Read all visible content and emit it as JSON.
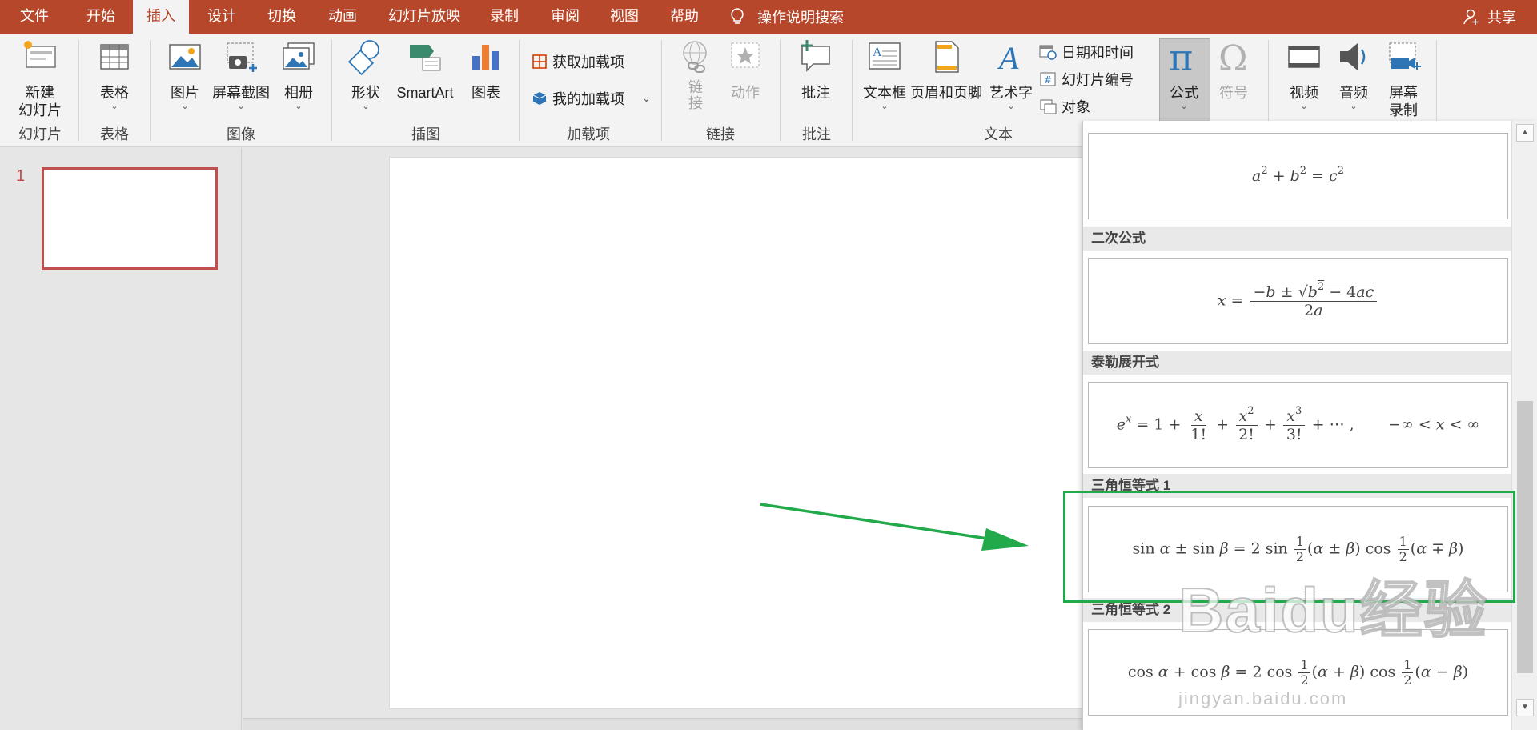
{
  "tabs": [
    "文件",
    "开始",
    "插入",
    "设计",
    "切换",
    "动画",
    "幻灯片放映",
    "录制",
    "审阅",
    "视图",
    "帮助"
  ],
  "active_tab": "插入",
  "tell_me": "操作说明搜索",
  "share": "共享",
  "ribbon": {
    "slides": {
      "new_slide": "新建\n幻灯片",
      "group": "幻灯片"
    },
    "tables": {
      "table": "表格",
      "group": "表格"
    },
    "images": {
      "pictures": "图片",
      "screenshot": "屏幕截图",
      "album": "相册",
      "group": "图像"
    },
    "illustrations": {
      "shapes": "形状",
      "smartart": "SmartArt",
      "chart": "图表",
      "group": "插图"
    },
    "addins": {
      "get": "获取加载项",
      "my": "我的加载项",
      "group": "加载项"
    },
    "links": {
      "link": "链\n接",
      "action": "动作",
      "group": "链接"
    },
    "comments": {
      "comment": "批注",
      "group": "批注"
    },
    "text": {
      "textbox": "文本框",
      "header_footer": "页眉和页脚",
      "wordart": "艺术字",
      "datetime": "日期和时间",
      "slide_number": "幻灯片编号",
      "object": "对象",
      "group": "文本"
    },
    "symbols": {
      "equation": "公式",
      "symbol": "符号"
    },
    "media": {
      "video": "视频",
      "audio": "音频",
      "screen_recording": "屏幕\n录制"
    }
  },
  "thumbnails": [
    {
      "number": "1"
    }
  ],
  "gallery": {
    "items": [
      {
        "title": "",
        "formula": "a² + b² = c²"
      },
      {
        "title": "二次公式",
        "formula": "x = (−b ± √(b² − 4ac)) / 2a"
      },
      {
        "title": "泰勒展开式",
        "formula": "eˣ = 1 + x/1! + x²/2! + x³/3! + ⋯ ,  −∞ < x < ∞"
      },
      {
        "title": "三角恒等式 1",
        "formula": "sin α ± sin β = 2 sin ½(α ± β) cos ½(α ∓ β)"
      },
      {
        "title": "三角恒等式 2",
        "formula": "cos α + cos β = 2 cos ½(α + β) cos ½(α − β)"
      }
    ],
    "highlighted": "三角恒等式 1"
  },
  "watermark": {
    "brand": "Baidu经验",
    "url": "jingyan.baidu.com"
  },
  "colors": {
    "accent": "#b7472a",
    "highlight": "#21a94a",
    "thumb_border": "#c0504d"
  }
}
